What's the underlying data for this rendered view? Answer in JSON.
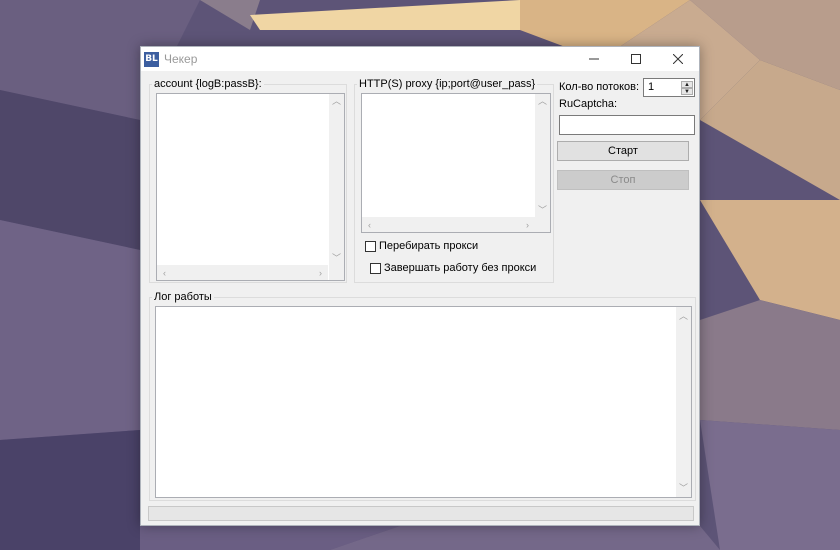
{
  "window": {
    "title": "Чекер",
    "icon_text": "BL"
  },
  "accounts": {
    "group_label": "account {logB:passB}:",
    "content": ""
  },
  "proxy": {
    "group_label": "HTTP(S) proxy {ip;port@user_pass}",
    "content": "",
    "rotate_label": "Перебирать прокси",
    "rotate_checked": false,
    "stop_without_proxy_label": "Завершать работу без прокси",
    "stop_without_proxy_checked": false
  },
  "settings": {
    "threads_label": "Кол-во потоков:",
    "threads_value": "1",
    "captcha_label": "RuCaptcha:",
    "captcha_value": ""
  },
  "buttons": {
    "start_label": "Старт",
    "stop_label": "Стоп"
  },
  "log": {
    "group_label": "Лог работы",
    "content": ""
  },
  "colors": {
    "desktop_base": "#5a5175",
    "accent_sand": "#d9b486",
    "window_bg": "#f0f0f0"
  },
  "icons": {
    "app": "app-logo-icon",
    "minimize": "minimize-icon",
    "maximize": "maximize-icon",
    "close": "close-icon"
  }
}
